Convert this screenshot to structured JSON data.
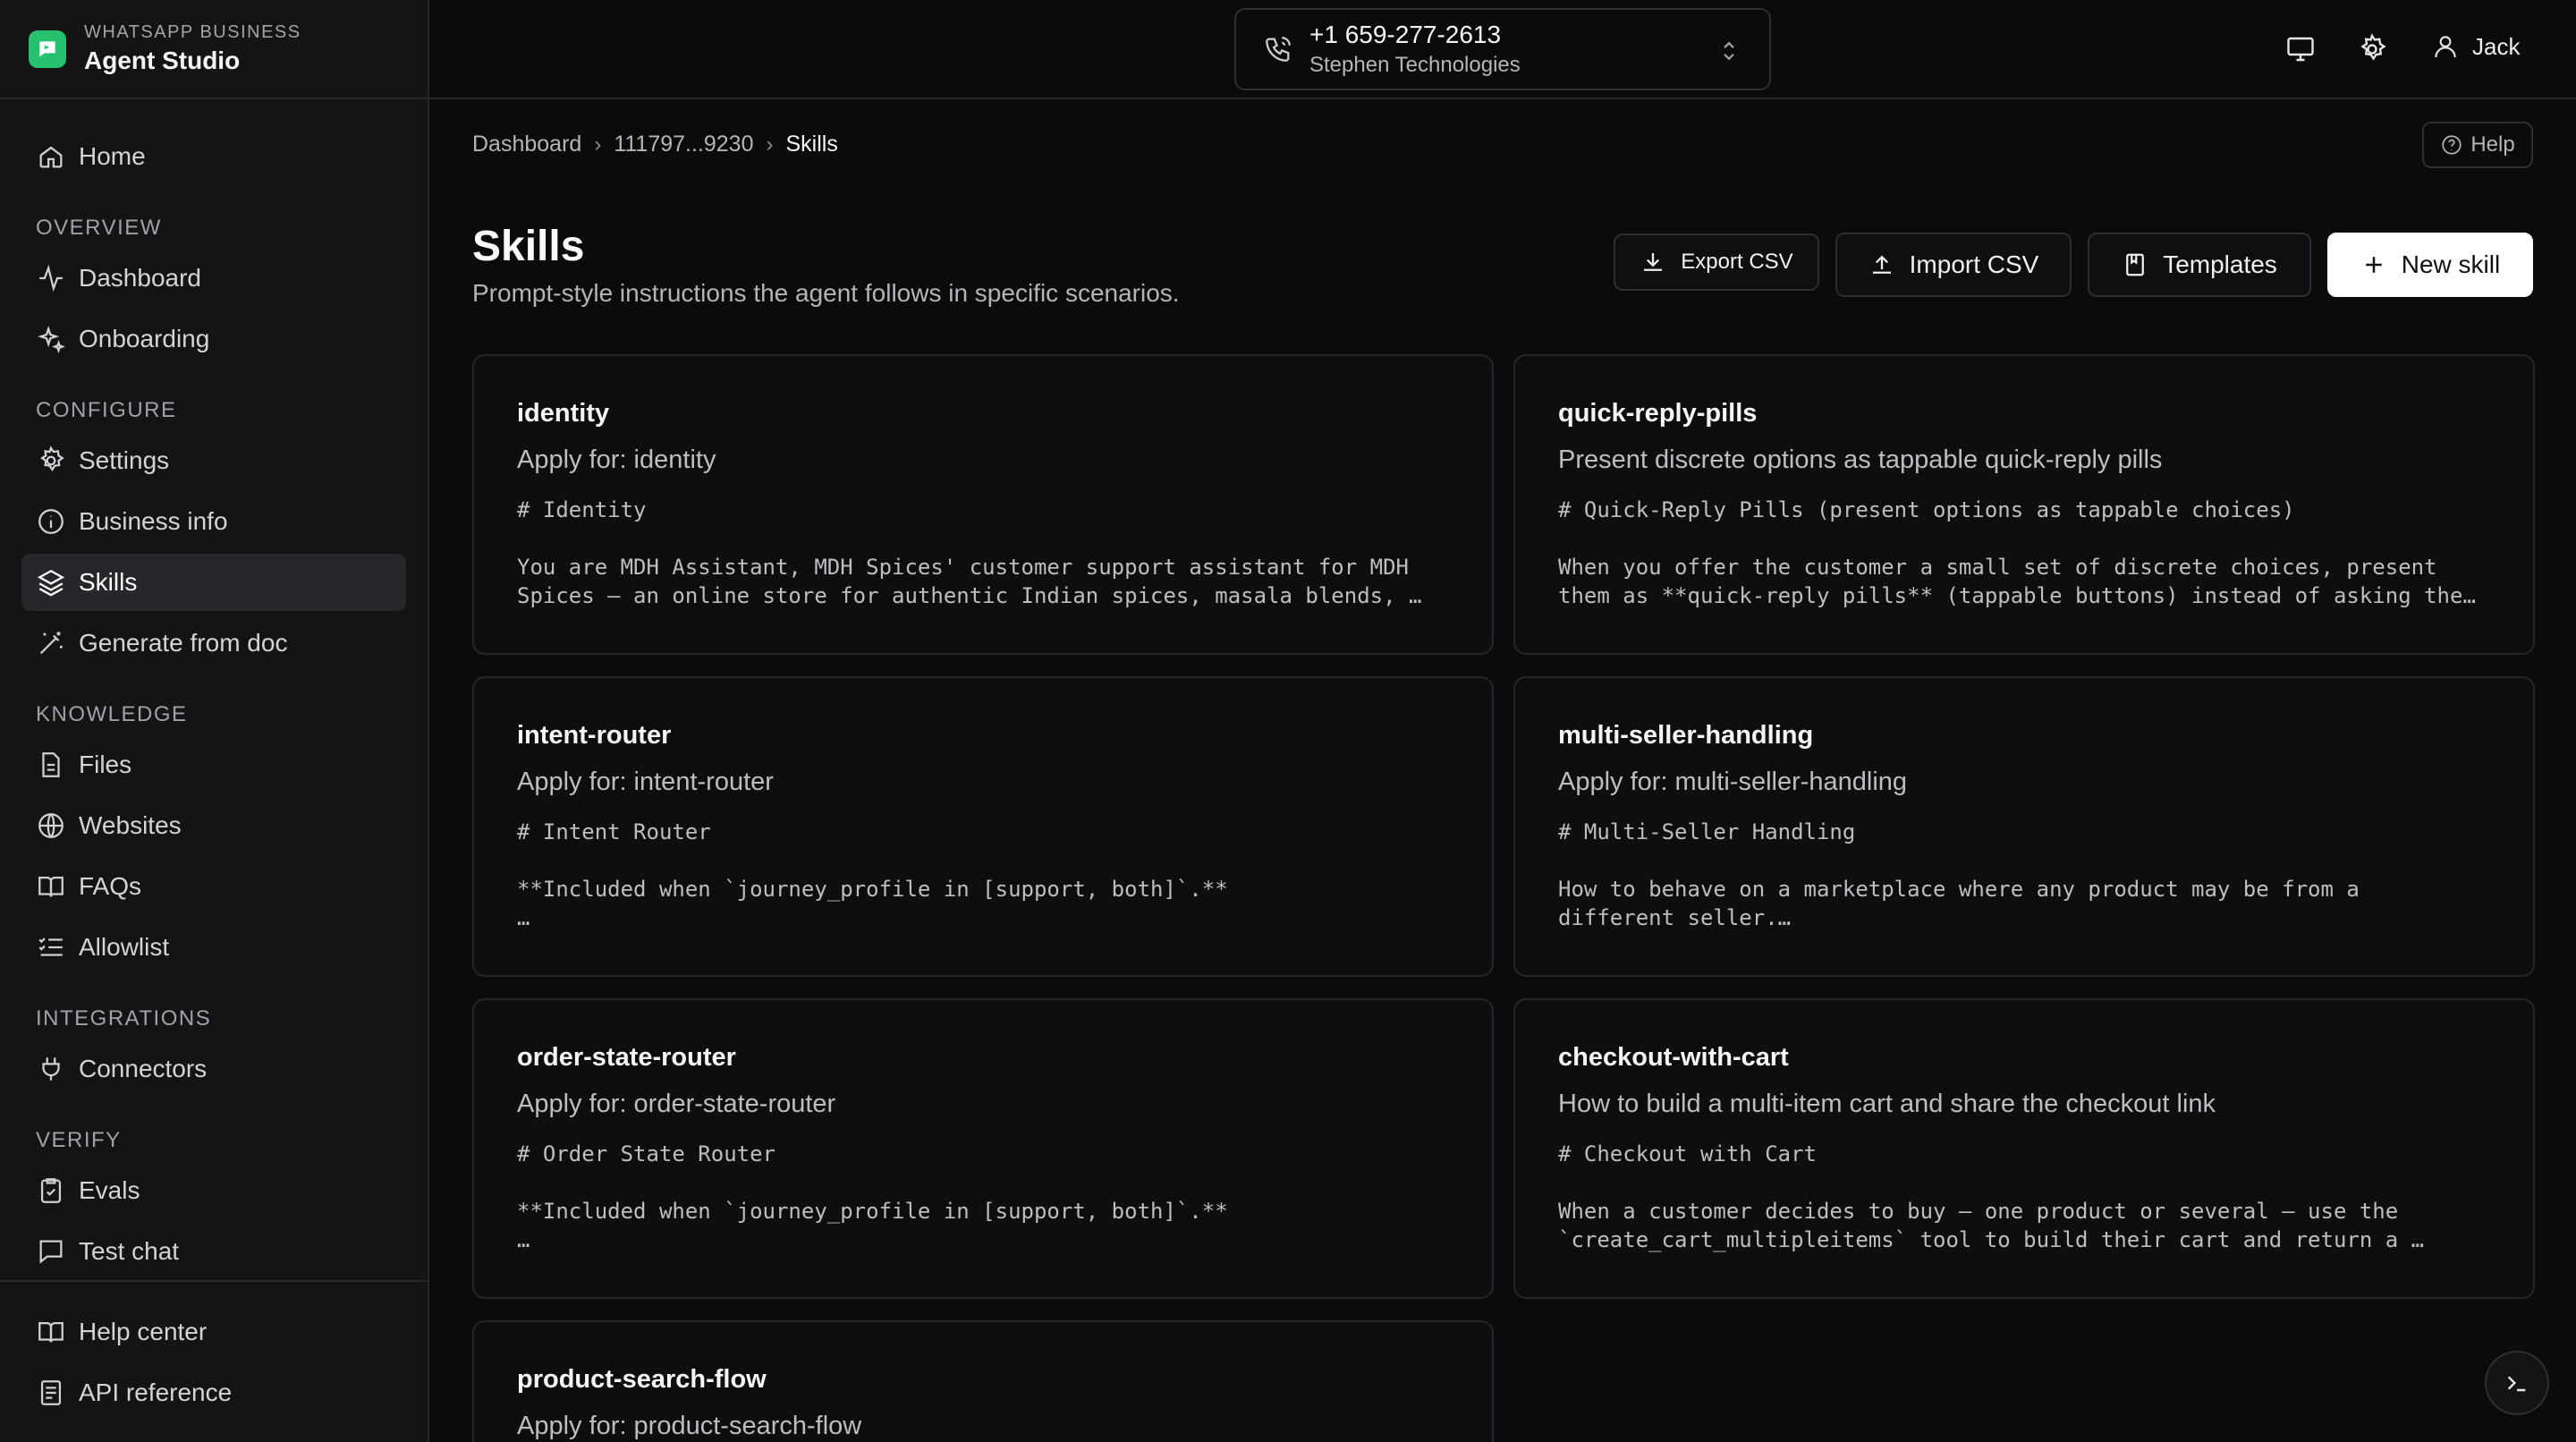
{
  "brand": {
    "supertitle": "WHATSAPP BUSINESS",
    "title": "Agent Studio"
  },
  "sidebar": {
    "home": "Home",
    "sections": {
      "overview": "OVERVIEW",
      "configure": "CONFIGURE",
      "knowledge": "KNOWLEDGE",
      "integrations": "INTEGRATIONS",
      "verify": "VERIFY"
    },
    "items": {
      "dashboard": "Dashboard",
      "onboarding": "Onboarding",
      "settings": "Settings",
      "business_info": "Business info",
      "skills": "Skills",
      "generate_from_doc": "Generate from doc",
      "files": "Files",
      "websites": "Websites",
      "faqs": "FAQs",
      "allowlist": "Allowlist",
      "connectors": "Connectors",
      "evals": "Evals",
      "test_chat": "Test chat"
    },
    "footer": {
      "help_center": "Help center",
      "api_reference": "API reference"
    },
    "active": "skills"
  },
  "topbar": {
    "phone_number": "+1 659-277-2613",
    "company": "Stephen Technologies",
    "user_name": "Jack"
  },
  "breadcrumb": {
    "root": "Dashboard",
    "middle": "111797...9230",
    "current": "Skills"
  },
  "help_label": "Help",
  "page": {
    "title": "Skills",
    "subtitle": "Prompt-style instructions the agent follows in specific scenarios."
  },
  "actions": {
    "export_csv": "Export CSV",
    "import_csv": "Import CSV",
    "templates": "Templates",
    "new_skill": "New skill"
  },
  "skills": [
    {
      "name": "identity",
      "description": "Apply for: identity",
      "heading": "# Identity",
      "body": "You are MDH Assistant, MDH Spices' customer support assistant for MDH\nSpices — an online store for authentic Indian spices, masala blends, …"
    },
    {
      "name": "quick-reply-pills",
      "description": "Present discrete options as tappable quick-reply pills",
      "heading": "# Quick-Reply Pills (present options as tappable choices)",
      "body": "When you offer the customer a small set of discrete choices, present\nthem as **quick-reply pills** (tappable buttons) instead of asking the…"
    },
    {
      "name": "intent-router",
      "description": "Apply for: intent-router",
      "heading": "# Intent Router",
      "body": "**Included when `journey_profile in [support, both]`.**\n…"
    },
    {
      "name": "multi-seller-handling",
      "description": "Apply for: multi-seller-handling",
      "heading": "# Multi-Seller Handling",
      "body": "How to behave on a marketplace where any product may be from a\ndifferent seller.…"
    },
    {
      "name": "order-state-router",
      "description": "Apply for: order-state-router",
      "heading": "# Order State Router",
      "body": "**Included when `journey_profile in [support, both]`.**\n…"
    },
    {
      "name": "checkout-with-cart",
      "description": "How to build a multi-item cart and share the checkout link",
      "heading": "# Checkout with Cart",
      "body": "When a customer decides to buy — one product or several — use the\n`create_cart_multipleitems` tool to build their cart and return a …"
    },
    {
      "name": "product-search-flow",
      "description": "Apply for: product-search-flow",
      "heading": "",
      "body": ""
    }
  ],
  "colors": {
    "accent": "#25c16f",
    "background": "#0b0b0c",
    "sidebar": "#141416"
  }
}
